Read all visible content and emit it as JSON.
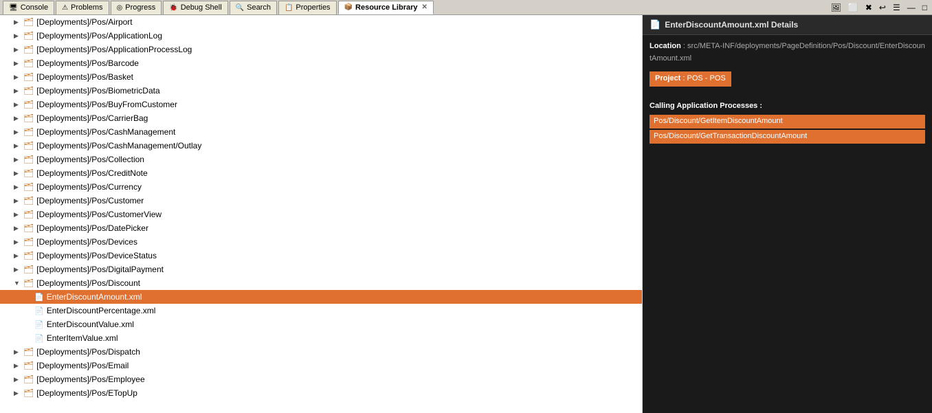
{
  "tabs": [
    {
      "id": "console",
      "label": "Console",
      "icon": "🖥",
      "active": false,
      "closeable": false
    },
    {
      "id": "problems",
      "label": "Problems",
      "icon": "⚠",
      "active": false,
      "closeable": false
    },
    {
      "id": "progress",
      "label": "Progress",
      "icon": "⏳",
      "active": false,
      "closeable": false
    },
    {
      "id": "debug",
      "label": "Debug Shell",
      "icon": "🐞",
      "active": false,
      "closeable": false
    },
    {
      "id": "search",
      "label": "Search",
      "icon": "🔍",
      "active": false,
      "closeable": false
    },
    {
      "id": "properties",
      "label": "Properties",
      "icon": "📋",
      "active": false,
      "closeable": false
    },
    {
      "id": "resource-library",
      "label": "Resource Library",
      "icon": "📦",
      "active": true,
      "closeable": true
    }
  ],
  "toolbar": {
    "buttons": [
      "🖼",
      "⬜",
      "✖",
      "↩",
      "☰",
      "—",
      "□"
    ]
  },
  "tree": {
    "items": [
      {
        "indent": 2,
        "type": "folder",
        "collapsed": true,
        "label": "[Deployments]/Pos/Airport"
      },
      {
        "indent": 2,
        "type": "folder",
        "collapsed": true,
        "label": "[Deployments]/Pos/ApplicationLog"
      },
      {
        "indent": 2,
        "type": "folder",
        "collapsed": true,
        "label": "[Deployments]/Pos/ApplicationProcessLog"
      },
      {
        "indent": 2,
        "type": "folder",
        "collapsed": true,
        "label": "[Deployments]/Pos/Barcode"
      },
      {
        "indent": 2,
        "type": "folder",
        "collapsed": true,
        "label": "[Deployments]/Pos/Basket"
      },
      {
        "indent": 2,
        "type": "folder",
        "collapsed": true,
        "label": "[Deployments]/Pos/BiometricData"
      },
      {
        "indent": 2,
        "type": "folder",
        "collapsed": true,
        "label": "[Deployments]/Pos/BuyFromCustomer"
      },
      {
        "indent": 2,
        "type": "folder",
        "collapsed": true,
        "label": "[Deployments]/Pos/CarrierBag"
      },
      {
        "indent": 2,
        "type": "folder",
        "collapsed": true,
        "label": "[Deployments]/Pos/CashManagement"
      },
      {
        "indent": 2,
        "type": "folder",
        "collapsed": true,
        "label": "[Deployments]/Pos/CashManagement/Outlay"
      },
      {
        "indent": 2,
        "type": "folder",
        "collapsed": true,
        "label": "[Deployments]/Pos/Collection"
      },
      {
        "indent": 2,
        "type": "folder",
        "collapsed": true,
        "label": "[Deployments]/Pos/CreditNote"
      },
      {
        "indent": 2,
        "type": "folder",
        "collapsed": true,
        "label": "[Deployments]/Pos/Currency"
      },
      {
        "indent": 2,
        "type": "folder",
        "collapsed": true,
        "label": "[Deployments]/Pos/Customer"
      },
      {
        "indent": 2,
        "type": "folder",
        "collapsed": true,
        "label": "[Deployments]/Pos/CustomerView"
      },
      {
        "indent": 2,
        "type": "folder",
        "collapsed": true,
        "label": "[Deployments]/Pos/DatePicker"
      },
      {
        "indent": 2,
        "type": "folder",
        "collapsed": true,
        "label": "[Deployments]/Pos/Devices"
      },
      {
        "indent": 2,
        "type": "folder",
        "collapsed": true,
        "label": "[Deployments]/Pos/DeviceStatus"
      },
      {
        "indent": 2,
        "type": "folder",
        "collapsed": true,
        "label": "[Deployments]/Pos/DigitalPayment"
      },
      {
        "indent": 2,
        "type": "folder",
        "collapsed": false,
        "label": "[Deployments]/Pos/Discount",
        "selected": false
      },
      {
        "indent": 3,
        "type": "file",
        "label": "EnterDiscountAmount.xml",
        "selected": true
      },
      {
        "indent": 3,
        "type": "file",
        "label": "EnterDiscountPercentage.xml",
        "selected": false
      },
      {
        "indent": 3,
        "type": "file",
        "label": "EnterDiscountValue.xml",
        "selected": false
      },
      {
        "indent": 3,
        "type": "file",
        "label": "EnterItemValue.xml",
        "selected": false
      },
      {
        "indent": 2,
        "type": "folder",
        "collapsed": true,
        "label": "[Deployments]/Pos/Dispatch"
      },
      {
        "indent": 2,
        "type": "folder",
        "collapsed": true,
        "label": "[Deployments]/Pos/Email"
      },
      {
        "indent": 2,
        "type": "folder",
        "collapsed": true,
        "label": "[Deployments]/Pos/Employee"
      },
      {
        "indent": 2,
        "type": "folder",
        "collapsed": true,
        "label": "[Deployments]/Pos/ETopUp"
      }
    ]
  },
  "details": {
    "title": "EnterDiscountAmount.xml Details",
    "icon": "📄",
    "location_label": "Location",
    "location_value": "src/META-INF/deployments/PageDefinition/Pos/Discount/EnterDiscountAmount.xml",
    "project_label": "Project",
    "project_value": "POS - POS",
    "calling_label": "Calling Application Processes :",
    "calling_items": [
      "Pos/Discount/GetItemDiscountAmount",
      "Pos/Discount/GetTransactionDiscountAmount"
    ]
  }
}
